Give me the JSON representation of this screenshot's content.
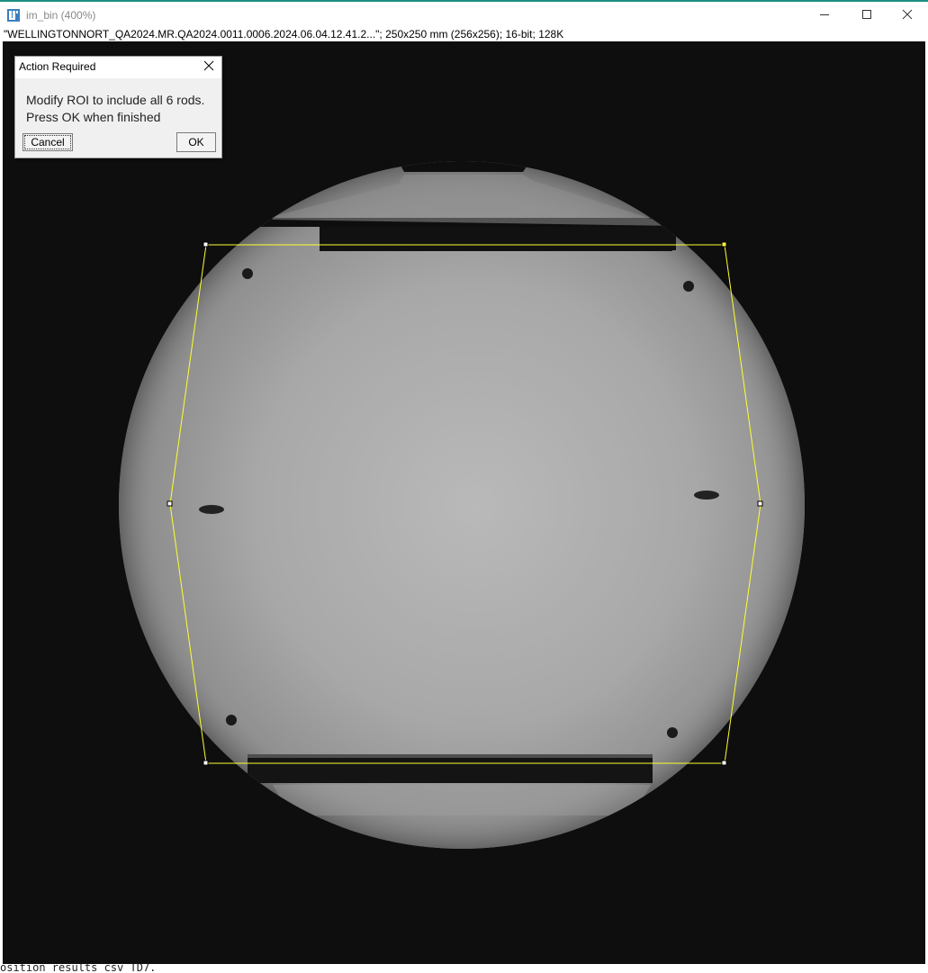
{
  "window": {
    "title": "im_bin (400%)",
    "image_info": "\"WELLINGTONNORT_QA2024.MR.QA2024.0011.0006.2024.06.04.12.41.2...\"; 250x250 mm (256x256); 16-bit; 128K",
    "icons": {
      "app": "imagej-icon",
      "minimize": "minimize-icon",
      "maximize": "maximize-icon",
      "close": "close-icon"
    }
  },
  "dialog": {
    "title": "Action Required",
    "message_line1": "Modify ROI to include all 6 rods.",
    "message_line2": "Press OK when finished",
    "cancel_label": "Cancel",
    "ok_label": "OK"
  },
  "console": {
    "partial_text": "osition results csv TD7."
  },
  "colors": {
    "accent": "#1f8f86",
    "roi": "#ffff33",
    "background": "#0e0e0e"
  }
}
